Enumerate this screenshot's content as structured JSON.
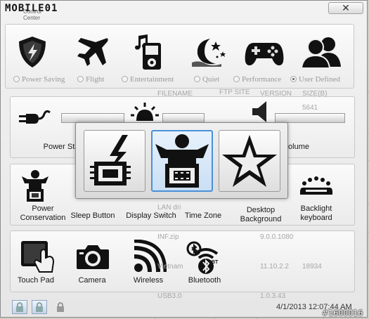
{
  "window": {
    "brand": "MOBILE01",
    "subtitle": "Control Center",
    "close_glyph": "✕"
  },
  "modes": [
    {
      "label": "Power Saving",
      "icon": "shield-battery-icon",
      "selected": false
    },
    {
      "label": "Flight",
      "icon": "airplane-icon",
      "selected": false
    },
    {
      "label": "Entertainment",
      "icon": "media-player-icon",
      "selected": false
    },
    {
      "label": "Quiet",
      "icon": "moon-stars-icon",
      "selected": false
    },
    {
      "label": "Performance",
      "icon": "gamepad-icon",
      "selected": false
    },
    {
      "label": "User Defined",
      "icon": "user-group-icon",
      "selected": true
    }
  ],
  "settings_row": {
    "power_state_label": "Power Sta",
    "volume_label": "olume"
  },
  "popup_modes": [
    {
      "name": "power-chip-mode",
      "icon": "lightning-chip-icon",
      "selected": false
    },
    {
      "name": "person-chip-mode",
      "icon": "person-chip-icon",
      "selected": true
    },
    {
      "name": "star-mode",
      "icon": "star-icon",
      "selected": false
    }
  ],
  "features": [
    {
      "label": "Power\nConservation",
      "icon": "person-chip-icon"
    },
    {
      "label": "Sleep Button",
      "icon": "sleep-icon"
    },
    {
      "label": "Display Switch",
      "icon": "display-icon"
    },
    {
      "label": "Time Zone",
      "icon": "clock-icon"
    },
    {
      "label": "Desktop\nBackground",
      "icon": "desktop-icon"
    },
    {
      "label": "Backlight\nkeyboard",
      "icon": "keyboard-light-icon"
    }
  ],
  "devices": [
    {
      "label": "Touch Pad",
      "icon": "touchpad-icon"
    },
    {
      "label": "Camera",
      "icon": "camera-icon"
    },
    {
      "label": "Wireless",
      "icon": "wifi-icon"
    },
    {
      "label": "Bluetooth",
      "icon": "bluetooth-icon"
    }
  ],
  "footer": {
    "datetime": "4/1/2013 12:07:44 AM",
    "watermark": "#1600016"
  },
  "background_text": {
    "filename": "FILENAME",
    "ftp_site": "FTP SITE",
    "version": "VERSION",
    "size": "SIZE(B)",
    "row1": "LAN dri",
    "row2": "INF.zip",
    "row3": "Vietnam",
    "row4": "USB3.0",
    "v1": "9.0.0.1080",
    "v2": "11.10.2.2",
    "v3": "1.0.3.43",
    "s1": "18934",
    "s2": "5641"
  }
}
